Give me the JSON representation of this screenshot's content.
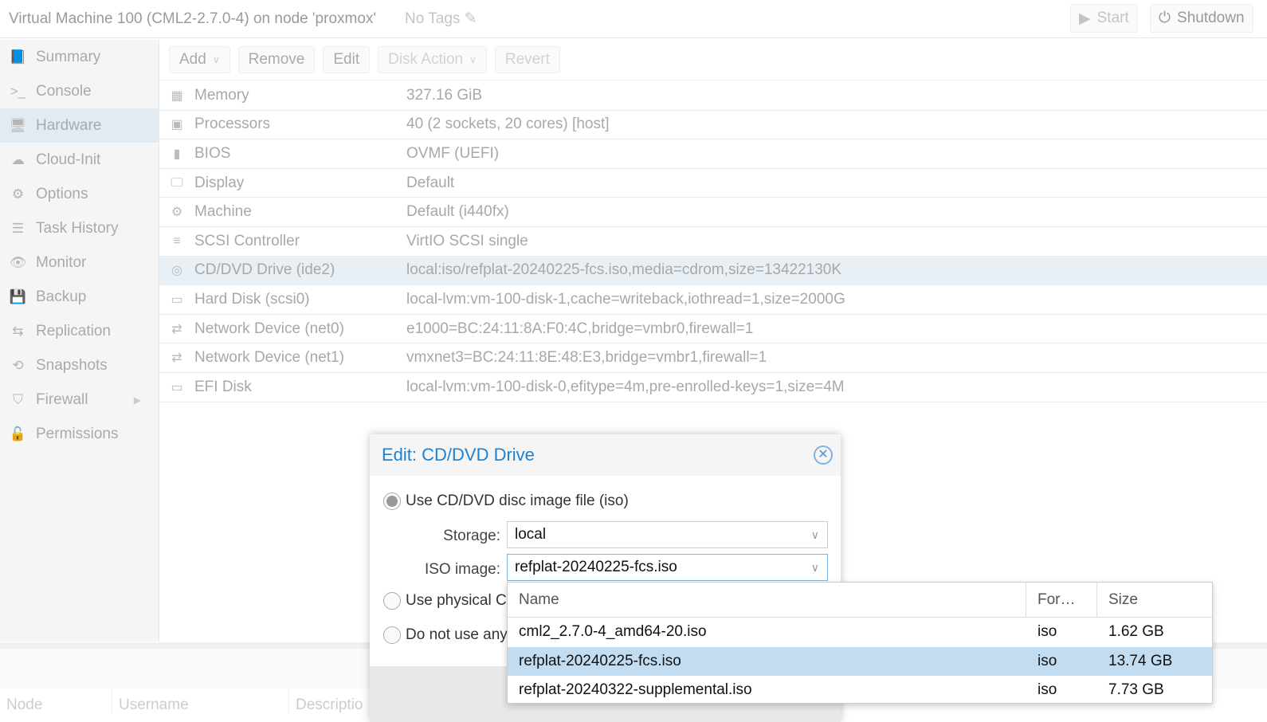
{
  "header": {
    "title": "Virtual Machine 100 (CML2-2.7.0-4) on node 'proxmox'",
    "tags": "No Tags",
    "start": "Start",
    "shutdown": "Shutdown"
  },
  "sidebar": {
    "items": [
      {
        "label": "Summary",
        "icon": "📘"
      },
      {
        "label": "Console",
        "icon": ">_"
      },
      {
        "label": "Hardware",
        "icon": "🖥"
      },
      {
        "label": "Cloud-Init",
        "icon": "☁"
      },
      {
        "label": "Options",
        "icon": "⚙"
      },
      {
        "label": "Task History",
        "icon": "☰"
      },
      {
        "label": "Monitor",
        "icon": "👁"
      },
      {
        "label": "Backup",
        "icon": "💾"
      },
      {
        "label": "Replication",
        "icon": "⇆"
      },
      {
        "label": "Snapshots",
        "icon": "⟲"
      },
      {
        "label": "Firewall",
        "icon": "⛉"
      },
      {
        "label": "Permissions",
        "icon": "🔓"
      }
    ]
  },
  "toolbar": {
    "add": "Add",
    "remove": "Remove",
    "edit": "Edit",
    "disk_action": "Disk Action",
    "revert": "Revert"
  },
  "hardware": [
    {
      "icon": "▦",
      "key": "Memory",
      "value": "327.16 GiB"
    },
    {
      "icon": "▣",
      "key": "Processors",
      "value": "40 (2 sockets, 20 cores) [host]"
    },
    {
      "icon": "▮",
      "key": "BIOS",
      "value": "OVMF (UEFI)"
    },
    {
      "icon": "🖵",
      "key": "Display",
      "value": "Default"
    },
    {
      "icon": "⚙",
      "key": "Machine",
      "value": "Default (i440fx)"
    },
    {
      "icon": "≡",
      "key": "SCSI Controller",
      "value": "VirtIO SCSI single"
    },
    {
      "icon": "◎",
      "key": "CD/DVD Drive (ide2)",
      "value": "local:iso/refplat-20240225-fcs.iso,media=cdrom,size=13422130K"
    },
    {
      "icon": "▭",
      "key": "Hard Disk (scsi0)",
      "value": "local-lvm:vm-100-disk-1,cache=writeback,iothread=1,size=2000G"
    },
    {
      "icon": "⇄",
      "key": "Network Device (net0)",
      "value": "e1000=BC:24:11:8A:F0:4C,bridge=vmbr0,firewall=1"
    },
    {
      "icon": "⇄",
      "key": "Network Device (net1)",
      "value": "vmxnet3=BC:24:11:8E:48:E3,bridge=vmbr1,firewall=1"
    },
    {
      "icon": "▭",
      "key": "EFI Disk",
      "value": "local-lvm:vm-100-disk-0,efitype=4m,pre-enrolled-keys=1,size=4M"
    }
  ],
  "bottom": {
    "columns": [
      "Node",
      "Username",
      "Descriptio"
    ]
  },
  "modal": {
    "title": "Edit: CD/DVD Drive",
    "opt_iso": "Use CD/DVD disc image file (iso)",
    "storage_label": "Storage:",
    "storage_value": "local",
    "iso_label": "ISO image:",
    "iso_value": "refplat-20240225-fcs.iso",
    "opt_physical": "Use physical C",
    "opt_none": "Do not use any"
  },
  "dropdown": {
    "headers": [
      "Name",
      "For…",
      "Size"
    ],
    "rows": [
      {
        "name": "cml2_2.7.0-4_amd64-20.iso",
        "format": "iso",
        "size": "1.62 GB"
      },
      {
        "name": "refplat-20240225-fcs.iso",
        "format": "iso",
        "size": "13.74 GB"
      },
      {
        "name": "refplat-20240322-supplemental.iso",
        "format": "iso",
        "size": "7.73 GB"
      }
    ]
  }
}
